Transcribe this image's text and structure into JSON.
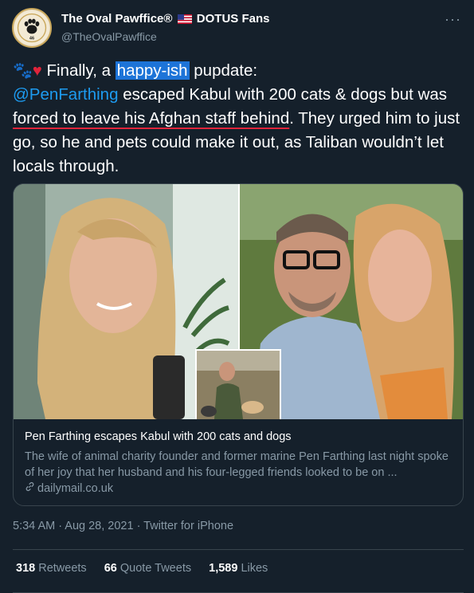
{
  "author": {
    "display_name_prefix": "The Oval Pawffice®",
    "display_name_suffix": "DOTUS Fans",
    "flag_icon": "us-flag-icon",
    "handle": "@TheOvalPawffice",
    "avatar_icon": "paw-seal-icon",
    "avatar_text": "46"
  },
  "more_icon": "···",
  "tweet": {
    "emoji_paw": "🐾",
    "emoji_heart": "♥",
    "text_1": " Finally, a ",
    "highlight": "happy-ish",
    "text_2": " pupdate:",
    "mention": "@PenFarthing",
    "text_3": " escaped Kabul with 200 cats & dogs but was ",
    "underlined": "forced to leave his Afghan staff behind",
    "text_4": ". They urged him to just go, so he and pets could make it out, as Taliban wouldn’t let locals through."
  },
  "card": {
    "title": "Pen Farthing escapes Kabul with 200 cats and dogs",
    "description": "The wife of animal charity founder and former marine Pen Farthing last night spoke of her joy that her husband and his four-legged friends looked to be on ...",
    "domain": "dailymail.co.uk",
    "link_icon": "link-icon"
  },
  "meta": "5:34 AM · Aug 28, 2021 · Twitter for iPhone",
  "stats": {
    "retweets_count": "318",
    "retweets_label": "Retweets",
    "quotes_count": "66",
    "quotes_label": "Quote Tweets",
    "likes_count": "1,589",
    "likes_label": "Likes"
  },
  "colors": {
    "background": "#15202b",
    "link": "#1d9bf0",
    "muted": "#8899a6",
    "border": "#38444d",
    "underline": "#e0243b",
    "highlight": "#1d74d8"
  }
}
